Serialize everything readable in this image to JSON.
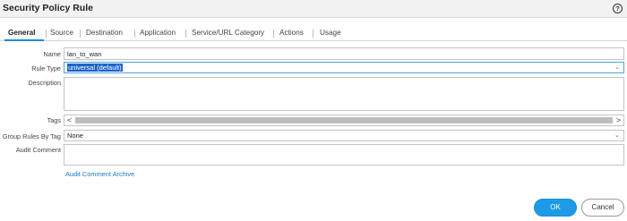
{
  "window": {
    "title": "Security Policy Rule",
    "help_icon": "?"
  },
  "tabs": [
    {
      "label": "General",
      "active": true
    },
    {
      "label": "Source"
    },
    {
      "label": "Destination"
    },
    {
      "label": "Application"
    },
    {
      "label": "Service/URL Category"
    },
    {
      "label": "Actions"
    },
    {
      "label": "Usage"
    }
  ],
  "form": {
    "name": {
      "label": "Name",
      "value": "lan_to_wan"
    },
    "rule_type": {
      "label": "Rule Type",
      "value": "universal (default)"
    },
    "description": {
      "label": "Description",
      "value": ""
    },
    "tags": {
      "label": "Tags",
      "left_arrow": "<",
      "right_arrow": ">"
    },
    "group_rules_by_tag": {
      "label": "Group Rules By Tag",
      "value": "None"
    },
    "audit_comment": {
      "label": "Audit Comment",
      "value": ""
    },
    "audit_comment_archive_link": "Audit Comment Archive"
  },
  "buttons": {
    "ok": "OK",
    "cancel": "Cancel"
  },
  "colors": {
    "accent": "#1e9be6",
    "link": "#1a7bbf",
    "tab_underline": "#1a8ad6"
  }
}
